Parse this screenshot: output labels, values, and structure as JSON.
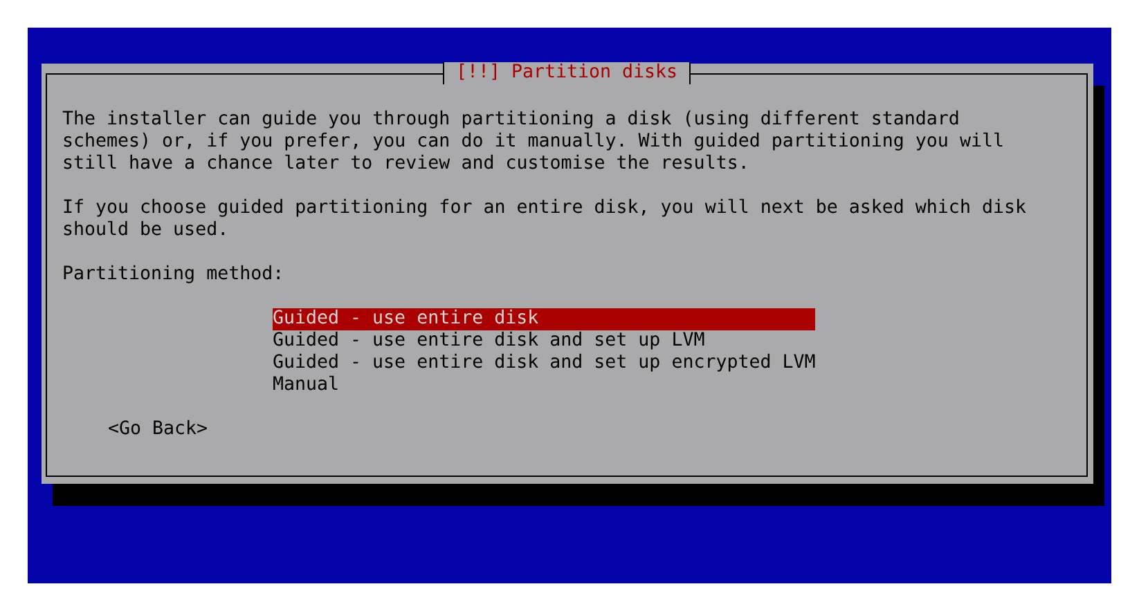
{
  "dialog": {
    "title": "[!!] Partition disks",
    "paragraphs": [
      "The installer can guide you through partitioning a disk (using different standard schemes) or, if you prefer, you can do it manually. With guided partitioning you will still have a chance later to review and customise the results.",
      "If you choose guided partitioning for an entire disk, you will next be asked which disk should be used."
    ],
    "prompt": "Partitioning method:",
    "options": [
      {
        "label": "Guided - use entire disk",
        "selected": true
      },
      {
        "label": "Guided - use entire disk and set up LVM",
        "selected": false
      },
      {
        "label": "Guided - use entire disk and set up encrypted LVM",
        "selected": false
      },
      {
        "label": "Manual",
        "selected": false
      }
    ],
    "back_button": "<Go Back>"
  }
}
